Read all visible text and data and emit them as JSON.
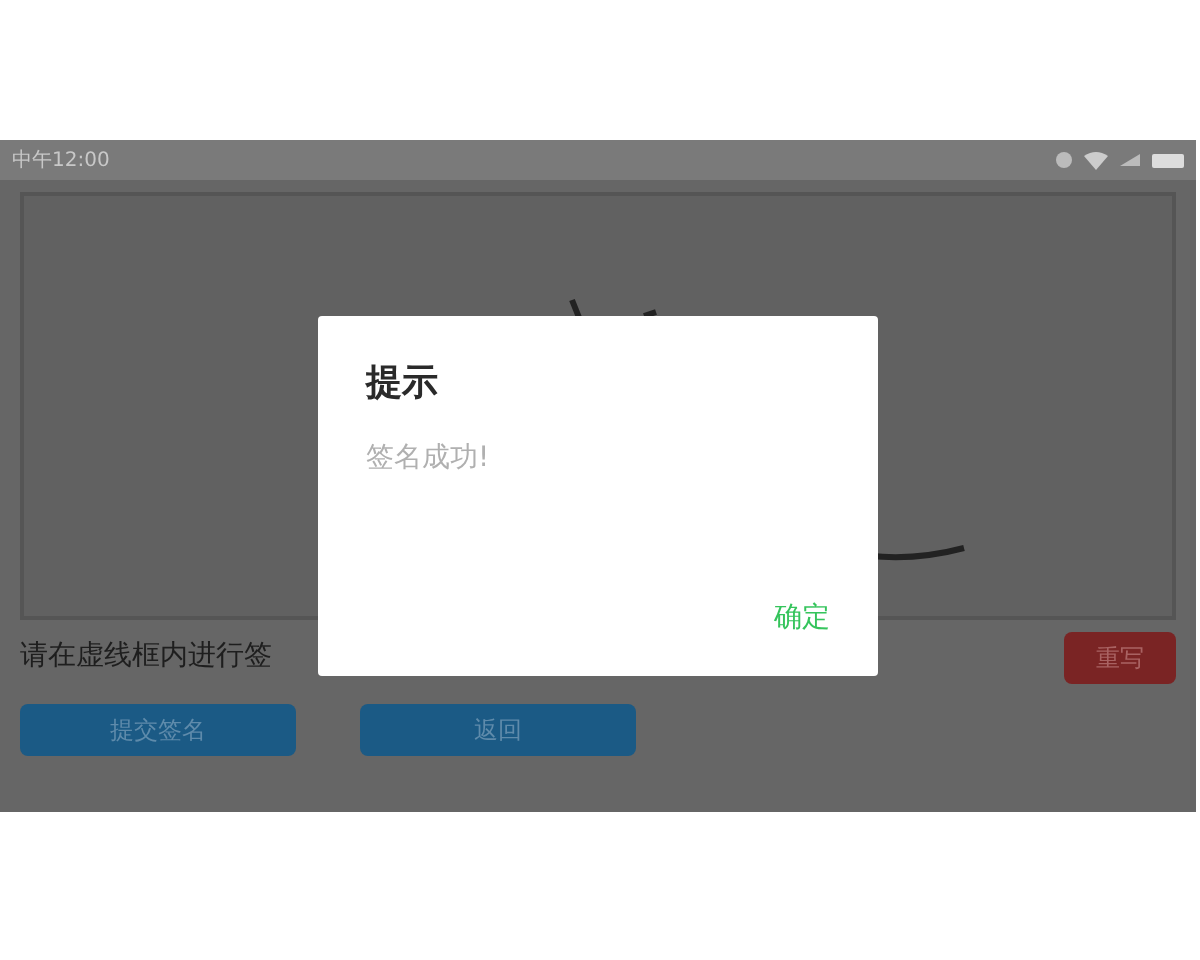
{
  "status_bar": {
    "time": "中午12:00"
  },
  "instruction": "请在虚线框内进行签",
  "buttons": [
    {
      "label": "重写",
      "kind": "danger"
    },
    {
      "label": "提交签名",
      "kind": "primary"
    },
    {
      "label": "返回",
      "kind": "primary"
    }
  ],
  "dialog": {
    "title": "提示",
    "message": "签名成功!",
    "confirm": "确定"
  }
}
